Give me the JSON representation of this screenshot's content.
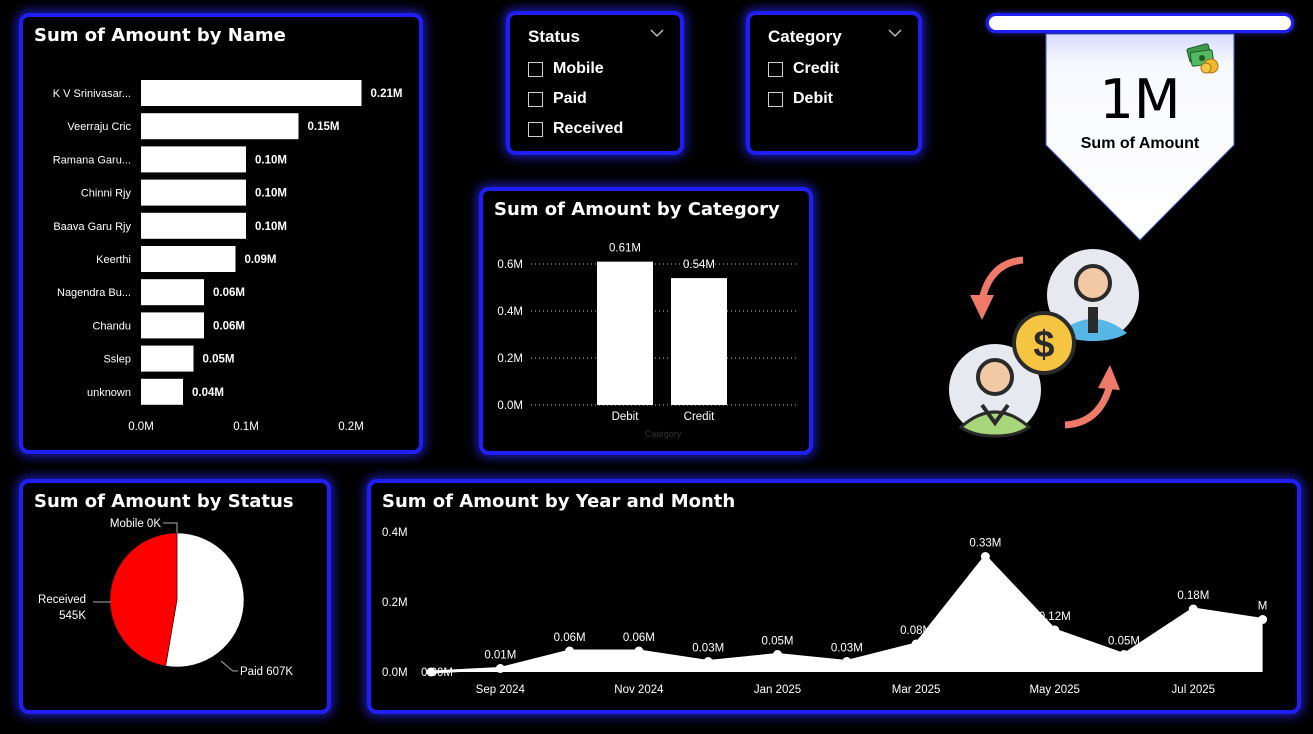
{
  "name_chart": {
    "title": "Sum of Amount by Name",
    "chart_data": {
      "type": "bar",
      "orientation": "horizontal",
      "title": "Sum of Amount by Name",
      "categories": [
        "K V Srinivasar...",
        "Veerraju Cric",
        "Ramana Garu...",
        "Chinni Rjy",
        "Baava Garu Rjy",
        "Keerthi",
        "Nagendra Bu...",
        "Chandu",
        "Sslep",
        "unknown"
      ],
      "values": [
        0.21,
        0.15,
        0.1,
        0.1,
        0.1,
        0.09,
        0.06,
        0.06,
        0.05,
        0.04
      ],
      "data_labels": [
        "0.21M",
        "0.15M",
        "0.10M",
        "0.10M",
        "0.10M",
        "0.09M",
        "0.06M",
        "0.06M",
        "0.05M",
        "0.04M"
      ],
      "x_ticks": [
        "0.0M",
        "0.1M",
        "0.2M"
      ],
      "xlim": [
        0,
        0.2
      ]
    }
  },
  "status_slicer": {
    "title": "Status",
    "options": [
      "Mobile",
      "Paid",
      "Received"
    ]
  },
  "category_slicer": {
    "title": "Category",
    "options": [
      "Credit",
      "Debit"
    ]
  },
  "kpi": {
    "value": "1M",
    "label": "Sum of Amount",
    "icon": "money-icon"
  },
  "category_chart": {
    "title": "Sum of Amount by Category",
    "chart_data": {
      "type": "bar",
      "title": "Sum of Amount by Category",
      "categories": [
        "Debit",
        "Credit"
      ],
      "values": [
        0.61,
        0.54
      ],
      "data_labels": [
        "0.61M",
        "0.54M"
      ],
      "y_ticks": [
        "0.0M",
        "0.2M",
        "0.4M",
        "0.6M"
      ],
      "ylim": [
        0,
        0.6
      ],
      "xlabel": "Category",
      "grid": true
    }
  },
  "illustration": {
    "description_icon": "money-transfer-icon"
  },
  "status_chart": {
    "title": "Sum of Amount by Status",
    "chart_data": {
      "type": "pie",
      "title": "Sum of Amount by Status",
      "labels": [
        "Mobile",
        "Paid",
        "Received"
      ],
      "values": [
        0,
        607,
        545
      ],
      "data_labels": [
        "Mobile 0K",
        "Paid 607K",
        "Received 545K"
      ],
      "colors": [
        "#888888",
        "#ffffff",
        "#ff0000"
      ]
    }
  },
  "month_chart": {
    "title": "Sum of Amount by Year and Month",
    "chart_data": {
      "type": "area",
      "title": "Sum of Amount by Year and Month",
      "x": [
        "2024-08",
        "2024-09",
        "2024-10",
        "2024-11",
        "2024-12",
        "2025-01",
        "2025-02",
        "2025-03",
        "2025-04",
        "2025-05",
        "2025-06",
        "2025-07",
        "2025-08"
      ],
      "values": [
        0.0,
        0.01,
        0.06,
        0.06,
        0.03,
        0.05,
        0.03,
        0.08,
        0.33,
        0.12,
        0.05,
        0.18,
        0.15
      ],
      "data_labels": [
        "0.00M",
        "0.01M",
        "0.06M",
        "0.06M",
        "0.03M",
        "0.05M",
        "0.03M",
        "0.08M",
        "0.33M",
        "0.12M",
        "0.05M",
        "0.18M",
        "M"
      ],
      "x_ticks": [
        "Sep 2024",
        "Nov 2024",
        "Jan 2025",
        "Mar 2025",
        "May 2025",
        "Jul 2025"
      ],
      "y_ticks": [
        "0.0M",
        "0.2M",
        "0.4M"
      ],
      "ylim": [
        0,
        0.4
      ]
    }
  },
  "colors": {
    "panel_border": "#1f1ff5",
    "bar": "#ffffff",
    "pie_received": "#ff0000",
    "kpi_card": "#f4f6ff"
  }
}
